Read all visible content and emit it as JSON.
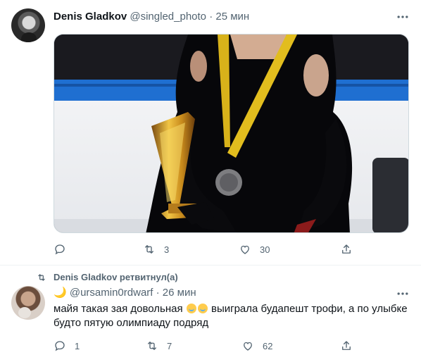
{
  "tweet1": {
    "author_name": "Denis Gladkov",
    "handle": "@singled_photo",
    "separator": "·",
    "time": "25 мин",
    "reply_count": "",
    "retweet_count": "3",
    "like_count": "30"
  },
  "tweet2": {
    "retweeted_by": "Denis Gladkov ретвитнул(а)",
    "moon_emoji": "🌙",
    "handle": "@ursamin0rdwarf",
    "separator": "·",
    "time": "26 мин",
    "text_part1": "майя такая зая довольная",
    "text_part2": "выиграла будапешт трофи, а по улыбке будто пятую олимпиаду подряд",
    "reply_count": "1",
    "retweet_count": "7",
    "like_count": "62"
  },
  "colors": {
    "muted": "#536471",
    "text": "#0f1419",
    "border": "#eff3f4"
  },
  "icons": [
    "more-icon",
    "reply-icon",
    "retweet-icon",
    "like-icon",
    "share-icon",
    "loudly-crying-face-emoji"
  ]
}
